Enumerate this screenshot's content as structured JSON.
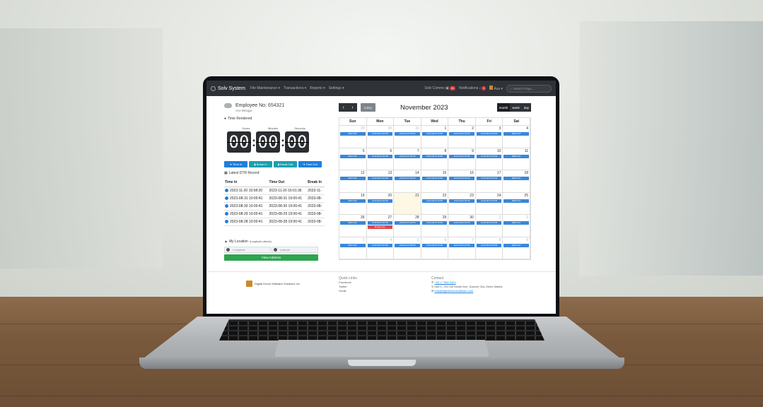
{
  "navbar": {
    "brand": "Solv System",
    "menus": [
      "File Maintenance ▾",
      "Transactions ▾",
      "Reports ▾",
      "Settings ▾"
    ],
    "solv_comms": "Solv Comms",
    "solv_comms_badge": "11",
    "notifications": "Notifications",
    "notifications_badge": "1",
    "user": "Ace ▾",
    "search_placeholder": "Search Page..."
  },
  "employee": {
    "label": "Employee No:",
    "number": "654321",
    "name": "Ace Beluga"
  },
  "time_rendered": {
    "title": "Time Rendered",
    "labels": [
      "Hours",
      "Minutes",
      "Seconds"
    ],
    "hours": "00",
    "minutes": "00",
    "seconds": "00"
  },
  "actions": [
    "Time In",
    "Break In",
    "Break Out",
    "Time Out"
  ],
  "dtr": {
    "title": "Latest DTR Record",
    "columns": [
      "Time In",
      "Time Out",
      "Break In"
    ],
    "rows": [
      {
        "time_in": "2023-11-20 15:58:20",
        "time_out": "2023-11-20 16:01:36",
        "break_in": "2023-11-"
      },
      {
        "time_in": "2023-08-31 10:00:41",
        "time_out": "2023-08-31 19:00:41",
        "break_in": "2023-08-"
      },
      {
        "time_in": "2023-08-30 10:00:41",
        "time_out": "2023-08-30 19:00:41",
        "break_in": "2023-08-"
      },
      {
        "time_in": "2023-08-29 10:00:41",
        "time_out": "2023-08-29 19:00:41",
        "break_in": "2023-08-"
      },
      {
        "time_in": "2023-08-28 10:00:41",
        "time_out": "2023-08-28 19:00:41",
        "break_in": "2023-08-"
      }
    ]
  },
  "location": {
    "title": "My Location",
    "subtitle": "(Longitude,Latitude)",
    "longitude_placeholder": "Longitude",
    "latitude_placeholder": "Latitude",
    "button": "View Address"
  },
  "calendar": {
    "title": "November 2023",
    "today_label": "today",
    "views": [
      "month",
      "week",
      "day"
    ],
    "days_of_week": [
      "Sun",
      "Mon",
      "Tue",
      "Wed",
      "Thu",
      "Fri",
      "Sat"
    ],
    "weeks": [
      [
        {
          "n": "29",
          "o": true,
          "e": "REST DAY"
        },
        {
          "n": "30",
          "o": true,
          "e": "10:00 AM-07:00 PM"
        },
        {
          "n": "31",
          "o": true,
          "e": "10:00 AM-07:00 PM"
        },
        {
          "n": "1",
          "e": "10:00 AM-07:00 PM"
        },
        {
          "n": "2",
          "e": "10:00 AM-07:00 PM"
        },
        {
          "n": "3",
          "e": "10:00 AM-07:00 PM"
        },
        {
          "n": "4",
          "e": "REST DAY"
        }
      ],
      [
        {
          "n": "5",
          "e": "REST DAY"
        },
        {
          "n": "6",
          "e": "10:00 AM-07:00 PM"
        },
        {
          "n": "7",
          "e": "10:00 AM-07:00 PM"
        },
        {
          "n": "8",
          "e": "10:00 AM-07:00 PM"
        },
        {
          "n": "9",
          "e": "10:00 AM-07:00 PM"
        },
        {
          "n": "10",
          "e": "10:00 AM-07:00 PM"
        },
        {
          "n": "11",
          "e": "REST DAY"
        }
      ],
      [
        {
          "n": "12",
          "e": "REST DAY"
        },
        {
          "n": "13",
          "e": "10:00 AM-07:00 PM"
        },
        {
          "n": "14",
          "e": "10:00 AM-07:00 PM"
        },
        {
          "n": "15",
          "e": "10:00 AM-07:00 PM"
        },
        {
          "n": "16",
          "e": "10:00 AM-07:00 PM"
        },
        {
          "n": "17",
          "e": "10:00 AM-07:00 PM"
        },
        {
          "n": "18",
          "e": "REST DAY"
        }
      ],
      [
        {
          "n": "19",
          "e": "REST DAY"
        },
        {
          "n": "20",
          "e": "10:00 AM-07:00 PM"
        },
        {
          "n": "21",
          "t": true
        },
        {
          "n": "22",
          "e": "10:00 AM-07:00 PM"
        },
        {
          "n": "23",
          "e": "10:00 AM-07:00 PM"
        },
        {
          "n": "24",
          "e": "10:00 AM-07:00 PM"
        },
        {
          "n": "25",
          "e": "REST DAY"
        }
      ],
      [
        {
          "n": "26",
          "e": "REST DAY"
        },
        {
          "n": "27",
          "e": "10:00 AM-07:00 PM",
          "e2": "Birthday Day"
        },
        {
          "n": "28",
          "e": "10:00 AM-07:00 PM"
        },
        {
          "n": "29",
          "e": "10:00 AM-07:00 PM"
        },
        {
          "n": "30",
          "e": "10:00 AM-07:00 PM"
        },
        {
          "n": "1",
          "o": true,
          "e": "10:00 AM-07:00 PM"
        },
        {
          "n": "2",
          "o": true,
          "e": "REST DAY"
        }
      ],
      [
        {
          "n": "3",
          "o": true,
          "e": "REST DAY"
        },
        {
          "n": "4",
          "o": true,
          "e": "10:00 AM-07:00 PM"
        },
        {
          "n": "5",
          "o": true,
          "e": "10:00 AM-07:00 PM"
        },
        {
          "n": "6",
          "o": true,
          "e": "10:00 AM-07:00 PM"
        },
        {
          "n": "7",
          "o": true,
          "e": "10:00 AM-07:00 PM"
        },
        {
          "n": "8",
          "o": true,
          "e": "10:00 AM-07:00 PM"
        },
        {
          "n": "9",
          "o": true,
          "e": "REST DAY"
        }
      ]
    ]
  },
  "footer": {
    "company": "Digital Doors Software Solutions Inc.",
    "quick_links_title": "Quick Links",
    "links": [
      "Facebook",
      "Twitter",
      "Gmail"
    ],
    "contact_title": "Contact",
    "phone": "+63 2 7358 9421",
    "address": "Unit C, 201 Del Monte Ave, Quezon City, Metro Manila",
    "email": "info@digitaldoorssoftware.com"
  }
}
